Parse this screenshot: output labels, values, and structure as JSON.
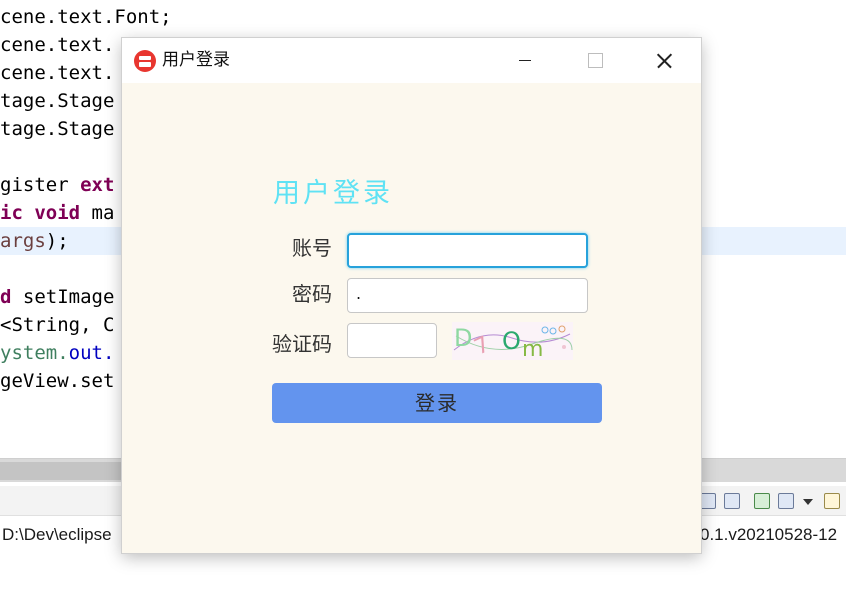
{
  "editor": {
    "lines": [
      {
        "parts": [
          {
            "t": "cene.text.Font;",
            "c": ""
          }
        ]
      },
      {
        "parts": [
          {
            "t": "cene.text.",
            "c": ""
          }
        ]
      },
      {
        "parts": [
          {
            "t": "cene.text.",
            "c": ""
          }
        ]
      },
      {
        "parts": [
          {
            "t": "tage.Stage",
            "c": ""
          }
        ]
      },
      {
        "parts": [
          {
            "t": "tage.Stage",
            "c": ""
          }
        ]
      },
      {
        "parts": [
          {
            "t": "",
            "c": ""
          }
        ]
      },
      {
        "parts": [
          {
            "t": "gister ",
            "c": ""
          },
          {
            "t": "ext",
            "c": "kw"
          }
        ]
      },
      {
        "parts": [
          {
            "t": "ic void",
            "c": "kw"
          },
          {
            "t": " ma",
            "c": ""
          }
        ]
      },
      {
        "parts": [
          {
            "t": "args",
            "c": "vname"
          },
          {
            "t": ");",
            "c": ""
          }
        ],
        "highlight": true
      },
      {
        "parts": [
          {
            "t": "",
            "c": ""
          }
        ]
      },
      {
        "parts": [
          {
            "t": "d",
            "c": "kw"
          },
          {
            "t": " setImage",
            "c": ""
          }
        ]
      },
      {
        "parts": [
          {
            "t": "<String, C",
            "c": ""
          }
        ]
      },
      {
        "parts": [
          {
            "t": "ystem.",
            "c": "grn"
          },
          {
            "t": "out.",
            "c": "fld"
          }
        ]
      },
      {
        "parts": [
          {
            "t": "geView.set",
            "c": ""
          }
        ]
      }
    ]
  },
  "statusbar": {
    "path_left": "D:\\Dev\\eclipse",
    "path_right": "0.1.v20210528-12"
  },
  "dialog": {
    "title": "用户登录",
    "heading": "用户登录",
    "account_label": "账号",
    "account_value": "",
    "password_label": "密码",
    "password_value": ".",
    "captcha_label": "验证码",
    "captcha_value": "",
    "captcha_text": "D7Om",
    "login_button": "登录"
  },
  "colors": {
    "heading": "#5fe2f4",
    "login_button_bg": "#6394ee",
    "dialog_bg": "#fcf8ee",
    "focus_border": "#27a2db",
    "app_icon": "#e8362f"
  },
  "icons": {
    "app": "app-logo-icon",
    "minimize": "minimize-icon",
    "maximize": "maximize-icon",
    "close": "close-icon"
  }
}
